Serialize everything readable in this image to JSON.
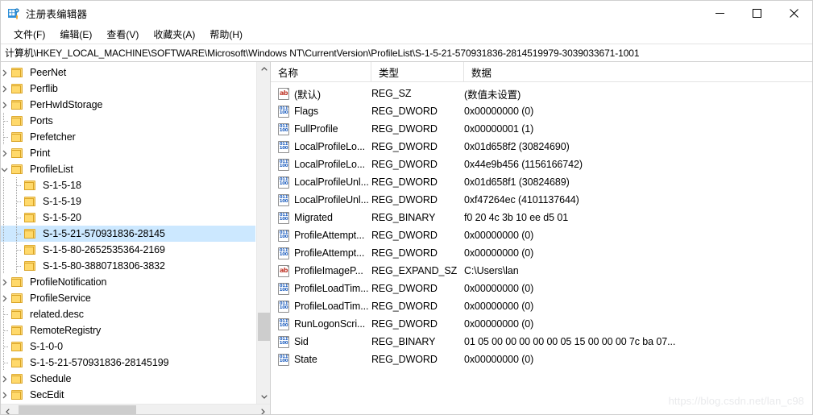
{
  "window": {
    "title": "注册表编辑器",
    "icon": "registry-editor-icon",
    "minimize_label": "─",
    "maximize_label": "□",
    "close_label": "✕"
  },
  "menu": {
    "items": [
      {
        "label": "文件(F)",
        "name": "menu-file"
      },
      {
        "label": "编辑(E)",
        "name": "menu-edit"
      },
      {
        "label": "查看(V)",
        "name": "menu-view"
      },
      {
        "label": "收藏夹(A)",
        "name": "menu-favorites"
      },
      {
        "label": "帮助(H)",
        "name": "menu-help"
      }
    ]
  },
  "address": {
    "path": "计算机\\HKEY_LOCAL_MACHINE\\SOFTWARE\\Microsoft\\Windows NT\\CurrentVersion\\ProfileList\\S-1-5-21-570931836-2814519979-3039033671-1001"
  },
  "tree": {
    "items": [
      {
        "label": "PeerNet",
        "depth": 1,
        "expander": "collapsed",
        "selected": false
      },
      {
        "label": "Perflib",
        "depth": 1,
        "expander": "collapsed",
        "selected": false
      },
      {
        "label": "PerHwIdStorage",
        "depth": 1,
        "expander": "collapsed",
        "selected": false
      },
      {
        "label": "Ports",
        "depth": 1,
        "expander": "none",
        "selected": false
      },
      {
        "label": "Prefetcher",
        "depth": 1,
        "expander": "none",
        "selected": false
      },
      {
        "label": "Print",
        "depth": 1,
        "expander": "collapsed",
        "selected": false
      },
      {
        "label": "ProfileList",
        "depth": 1,
        "expander": "expanded",
        "selected": false
      },
      {
        "label": "S-1-5-18",
        "depth": 2,
        "expander": "none",
        "selected": false
      },
      {
        "label": "S-1-5-19",
        "depth": 2,
        "expander": "none",
        "selected": false
      },
      {
        "label": "S-1-5-20",
        "depth": 2,
        "expander": "none",
        "selected": false
      },
      {
        "label": "S-1-5-21-570931836-28145",
        "depth": 2,
        "expander": "none",
        "selected": true
      },
      {
        "label": "S-1-5-80-2652535364-2169",
        "depth": 2,
        "expander": "none",
        "selected": false
      },
      {
        "label": "S-1-5-80-3880718306-3832",
        "depth": 2,
        "expander": "none",
        "selected": false
      },
      {
        "label": "ProfileNotification",
        "depth": 1,
        "expander": "collapsed",
        "selected": false
      },
      {
        "label": "ProfileService",
        "depth": 1,
        "expander": "collapsed",
        "selected": false
      },
      {
        "label": "related.desc",
        "depth": 1,
        "expander": "none",
        "selected": false
      },
      {
        "label": "RemoteRegistry",
        "depth": 1,
        "expander": "none",
        "selected": false
      },
      {
        "label": "S-1-0-0",
        "depth": 1,
        "expander": "none",
        "selected": false
      },
      {
        "label": "S-1-5-21-570931836-28145199",
        "depth": 1,
        "expander": "none",
        "selected": false
      },
      {
        "label": "Schedule",
        "depth": 1,
        "expander": "collapsed",
        "selected": false
      },
      {
        "label": "SecEdit",
        "depth": 1,
        "expander": "collapsed",
        "selected": false
      }
    ]
  },
  "list": {
    "columns": [
      {
        "label": "名称",
        "name": "column-name"
      },
      {
        "label": "类型",
        "name": "column-type"
      },
      {
        "label": "数据",
        "name": "column-data"
      }
    ],
    "rows": [
      {
        "name": "(默认)",
        "icon": "string-value-icon",
        "type": "REG_SZ",
        "data": "(数值未设置)"
      },
      {
        "name": "Flags",
        "icon": "dword-value-icon",
        "type": "REG_DWORD",
        "data": "0x00000000 (0)"
      },
      {
        "name": "FullProfile",
        "icon": "dword-value-icon",
        "type": "REG_DWORD",
        "data": "0x00000001 (1)"
      },
      {
        "name": "LocalProfileLo...",
        "icon": "dword-value-icon",
        "type": "REG_DWORD",
        "data": "0x01d658f2 (30824690)"
      },
      {
        "name": "LocalProfileLo...",
        "icon": "dword-value-icon",
        "type": "REG_DWORD",
        "data": "0x44e9b456 (1156166742)"
      },
      {
        "name": "LocalProfileUnl...",
        "icon": "dword-value-icon",
        "type": "REG_DWORD",
        "data": "0x01d658f1 (30824689)"
      },
      {
        "name": "LocalProfileUnl...",
        "icon": "dword-value-icon",
        "type": "REG_DWORD",
        "data": "0xf47264ec (4101137644)"
      },
      {
        "name": "Migrated",
        "icon": "dword-value-icon",
        "type": "REG_BINARY",
        "data": "f0 20 4c 3b 10 ee d5 01"
      },
      {
        "name": "ProfileAttempt...",
        "icon": "dword-value-icon",
        "type": "REG_DWORD",
        "data": "0x00000000 (0)"
      },
      {
        "name": "ProfileAttempt...",
        "icon": "dword-value-icon",
        "type": "REG_DWORD",
        "data": "0x00000000 (0)"
      },
      {
        "name": "ProfileImageP...",
        "icon": "string-value-icon",
        "type": "REG_EXPAND_SZ",
        "data": "C:\\Users\\lan"
      },
      {
        "name": "ProfileLoadTim...",
        "icon": "dword-value-icon",
        "type": "REG_DWORD",
        "data": "0x00000000 (0)"
      },
      {
        "name": "ProfileLoadTim...",
        "icon": "dword-value-icon",
        "type": "REG_DWORD",
        "data": "0x00000000 (0)"
      },
      {
        "name": "RunLogonScri...",
        "icon": "dword-value-icon",
        "type": "REG_DWORD",
        "data": "0x00000000 (0)"
      },
      {
        "name": "Sid",
        "icon": "dword-value-icon",
        "type": "REG_BINARY",
        "data": "01 05 00 00 00 00 00 05 15 00 00 00 7c ba 07..."
      },
      {
        "name": "State",
        "icon": "dword-value-icon",
        "type": "REG_DWORD",
        "data": "0x00000000 (0)"
      }
    ]
  },
  "watermark": {
    "text": "https://blog.csdn.net/lan_c98"
  },
  "colors": {
    "selection": "#cce8ff",
    "folder": "#ffd96b",
    "scrollbar_thumb": "#cdcdcd",
    "string_icon": "#c0392b",
    "dword_icon": "#1f5fbf"
  }
}
